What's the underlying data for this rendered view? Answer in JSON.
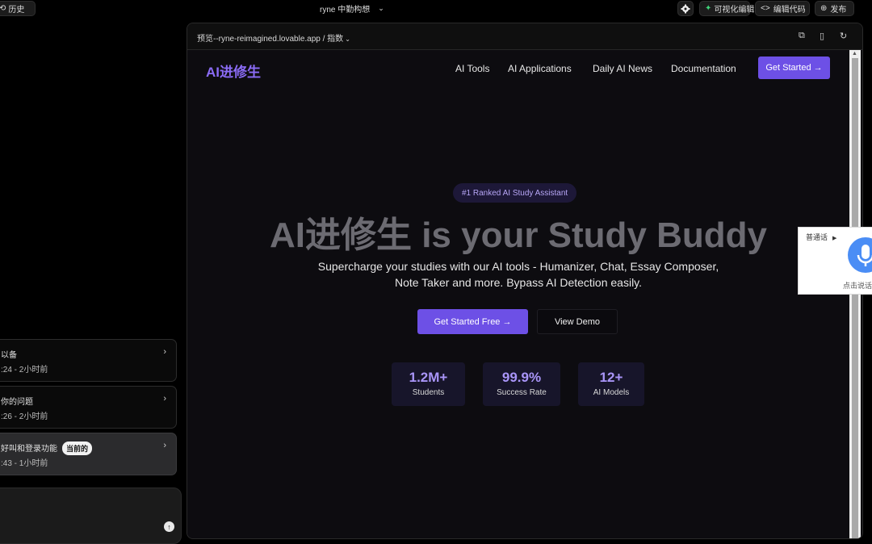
{
  "topbar": {
    "history_label": "历史",
    "project_name": "ryne 中勤构想",
    "settings_icon": "gear-icon",
    "visual_edit_label": "可视化编辑",
    "code_label": "编辑代码",
    "publish_label": "发布"
  },
  "history": {
    "items": [
      {
        "title": "以备",
        "time": ":24 - 2小时前"
      },
      {
        "title": "你的问题",
        "time": ":26 - 2小时前"
      },
      {
        "title": "好叫和登录功能",
        "time": ":43 - 1小时前",
        "badge": "当前的"
      }
    ]
  },
  "preview": {
    "url": "预览--ryne-reimagined.lovable.app / 指数",
    "site": {
      "logo": "AI进修生",
      "nav": [
        "AI Tools",
        "AI Applications",
        "Daily AI News",
        "Documentation"
      ],
      "nav_cta": "Get Started →",
      "badge": "#1 Ranked AI Study Assistant",
      "title": "AI进修生 is your Study Buddy",
      "subtitle": "Supercharge your studies with our AI tools - Humanizer, Chat, Essay Composer, Note Taker and more. Bypass AI Detection easily.",
      "primary_button": "Get Started Free →",
      "secondary_button": "View Demo",
      "stats": [
        {
          "value": "1.2M+",
          "label": "Students"
        },
        {
          "value": "99.9%",
          "label": "Success Rate"
        },
        {
          "value": "12+",
          "label": "AI Models"
        }
      ]
    }
  },
  "voice_widget": {
    "label": "普通话",
    "hint": "点击说话"
  },
  "colors": {
    "accent": "#6d50e6",
    "accent_text": "#a995f8",
    "background": "#0d0c10"
  }
}
